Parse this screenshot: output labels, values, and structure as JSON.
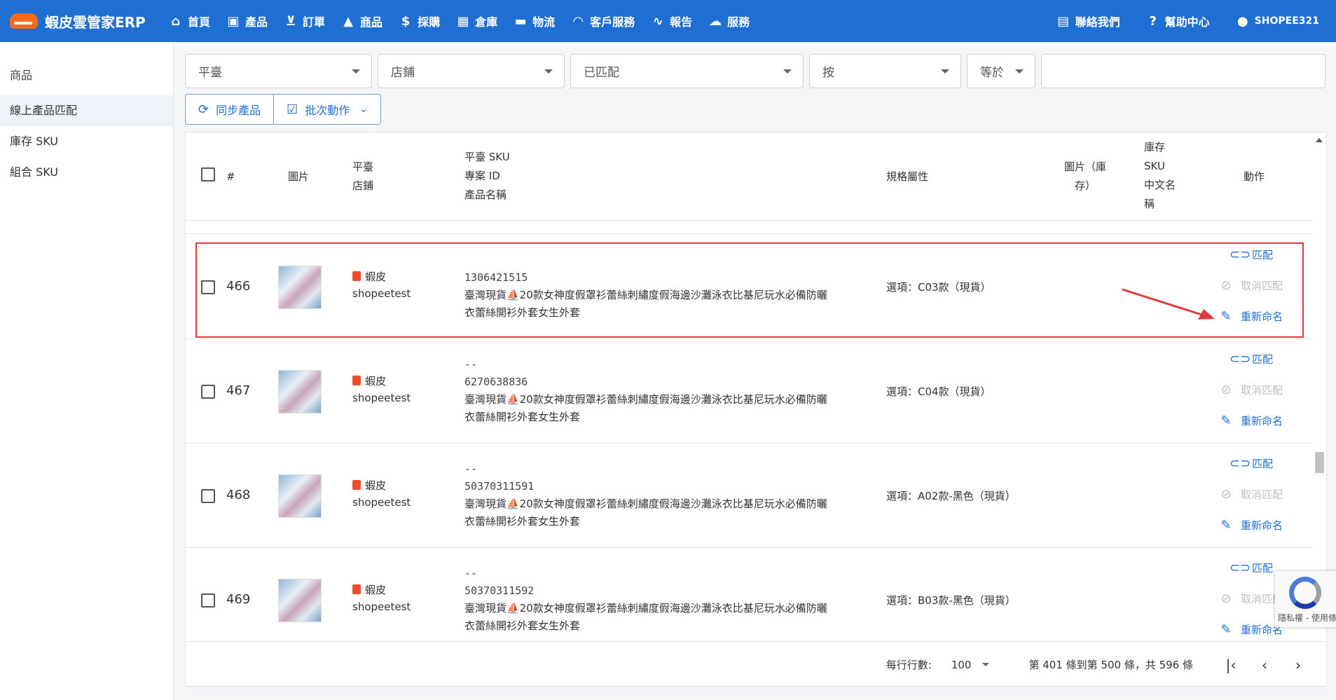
{
  "header": {
    "brand": "蝦皮雲管家ERP",
    "nav": [
      {
        "label": "首頁",
        "icon": "home-icon"
      },
      {
        "label": "產品",
        "icon": "bag-icon"
      },
      {
        "label": "訂單",
        "icon": "cart-icon"
      },
      {
        "label": "商品",
        "icon": "shapes-icon"
      },
      {
        "label": "採購",
        "icon": "dollar-icon"
      },
      {
        "label": "倉庫",
        "icon": "warehouse-icon"
      },
      {
        "label": "物流",
        "icon": "truck-icon"
      },
      {
        "label": "客戶服務",
        "icon": "headset-icon"
      },
      {
        "label": "報告",
        "icon": "chart-icon"
      },
      {
        "label": "服務",
        "icon": "cloud-icon"
      }
    ],
    "right": [
      {
        "label": "聯絡我們",
        "icon": "contact-icon"
      },
      {
        "label": "幫助中心",
        "icon": "help-icon"
      },
      {
        "label": "SHOPEE321",
        "icon": "account-icon"
      }
    ]
  },
  "sidebar": {
    "title": "商品",
    "items": [
      {
        "label": "線上產品匹配",
        "active": true
      },
      {
        "label": "庫存 SKU",
        "active": false
      },
      {
        "label": "組合 SKU",
        "active": false
      }
    ]
  },
  "filters": {
    "platform": "平臺",
    "store": "店鋪",
    "match_status": "已匹配",
    "field": "按",
    "operator": "等於",
    "value": ""
  },
  "toolbar": {
    "sync_label": "同步產品",
    "batch_label": "批次動作"
  },
  "table": {
    "headers": {
      "index": "#",
      "image": "圖片",
      "platform": "平臺",
      "store": "店鋪",
      "platform_sku": "平臺 SKU",
      "project_id": "專案 ID",
      "product_name": "產品名稱",
      "spec": "規格屬性",
      "stock_image_1": "圖片（庫",
      "stock_image_2": "存）",
      "stock_1": "庫存",
      "stock_2": "SKU",
      "stock_3": "中文名",
      "stock_4": "稱",
      "actions": "動作"
    },
    "rows": [
      {
        "num": "466",
        "platform": "蝦皮",
        "store": "shopeetest",
        "sku": "",
        "id": "1306421515",
        "name_1": "臺灣現貨⛵20款女神度假罩衫蕾絲刺繡度假海邊沙灘泳衣比基尼玩水必備防曬",
        "name_2": "衣蕾絲開衫外套女生外套",
        "spec": "選項：C03款（現貨）"
      },
      {
        "num": "467",
        "platform": "蝦皮",
        "store": "shopeetest",
        "sku": "--",
        "id": "6270638836",
        "name_1": "臺灣現貨⛵20款女神度假罩衫蕾絲刺繡度假海邊沙灘泳衣比基尼玩水必備防曬",
        "name_2": "衣蕾絲開衫外套女生外套",
        "spec": "選項：C04款（現貨）"
      },
      {
        "num": "468",
        "platform": "蝦皮",
        "store": "shopeetest",
        "sku": "--",
        "id": "50370311591",
        "name_1": "臺灣現貨⛵20款女神度假罩衫蕾絲刺繡度假海邊沙灘泳衣比基尼玩水必備防曬",
        "name_2": "衣蕾絲開衫外套女生外套",
        "spec": "選項：A02款-黑色（現貨）"
      },
      {
        "num": "469",
        "platform": "蝦皮",
        "store": "shopeetest",
        "sku": "--",
        "id": "50370311592",
        "name_1": "臺灣現貨⛵20款女神度假罩衫蕾絲刺繡度假海邊沙灘泳衣比基尼玩水必備防曬",
        "name_2": "衣蕾絲開衫外套女生外套",
        "spec": "選項：B03款-黑色（現貨）"
      }
    ],
    "actions": {
      "match": "匹配",
      "unmatch": "取消匹配",
      "rename": "重新命名"
    }
  },
  "footer": {
    "rows_per_page_label": "每行行數:",
    "rows_per_page": "100",
    "range": "第 401 條到第 500 條，共 596 條"
  },
  "recaptcha": {
    "text": "隱私權 - 使用條款"
  },
  "colors": {
    "header": "#1f6fd2",
    "highlight": "#e23b3b",
    "link": "#1f6fd2"
  }
}
